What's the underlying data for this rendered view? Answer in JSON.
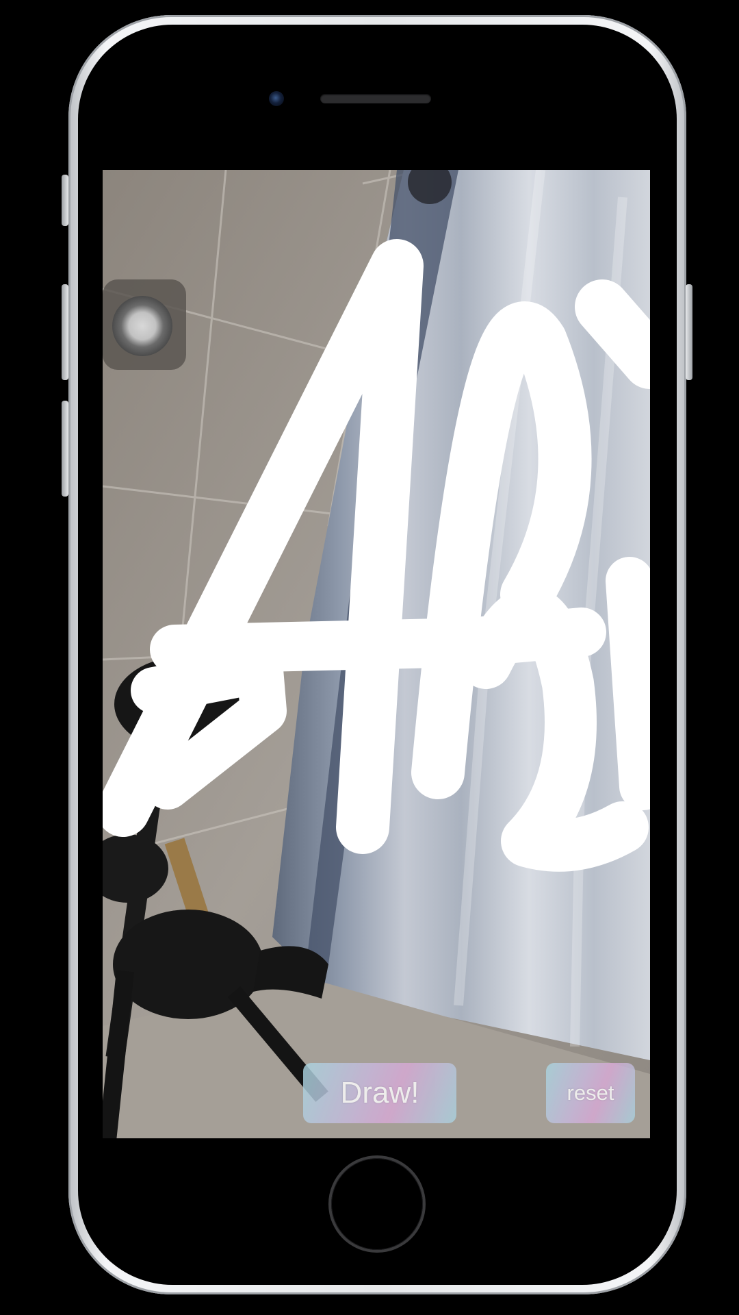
{
  "ar_view": {
    "draw_button_label": "Draw!",
    "reset_button_label": "reset"
  },
  "colors": {
    "button_gradient_start": "#a9d6e0",
    "button_gradient_mid": "#d8a9d6",
    "stroke_color": "#ffffff"
  },
  "icons": [
    "camera-icon",
    "speaker-grille",
    "home-button"
  ]
}
